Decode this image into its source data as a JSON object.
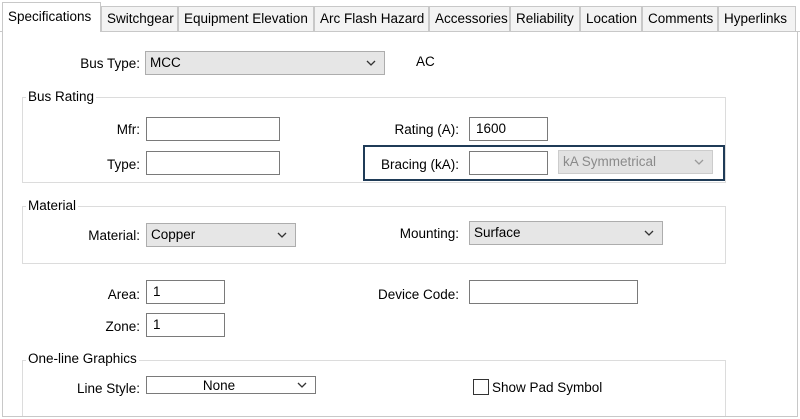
{
  "tabs": [
    {
      "label": "Specifications"
    },
    {
      "label": "Switchgear"
    },
    {
      "label": "Equipment Elevation"
    },
    {
      "label": "Arc Flash Hazard"
    },
    {
      "label": "Accessories"
    },
    {
      "label": "Reliability"
    },
    {
      "label": "Location"
    },
    {
      "label": "Comments"
    },
    {
      "label": "Hyperlinks"
    }
  ],
  "bus_type": {
    "label": "Bus Type:",
    "value": "MCC",
    "current": "AC"
  },
  "bus_rating": {
    "title": "Bus Rating",
    "mfr_label": "Mfr:",
    "mfr_value": "",
    "type_label": "Type:",
    "type_value": "",
    "rating_label": "Rating (A):",
    "rating_value": "1600",
    "bracing_label": "Bracing (kA):",
    "bracing_value": "",
    "bracing_unit": "kA Symmetrical"
  },
  "material": {
    "title": "Material",
    "material_label": "Material:",
    "material_value": "Copper",
    "mounting_label": "Mounting:",
    "mounting_value": "Surface"
  },
  "area": {
    "label": "Area:",
    "value": "1"
  },
  "zone": {
    "label": "Zone:",
    "value": "1"
  },
  "device_code": {
    "label": "Device Code:",
    "value": ""
  },
  "oneline": {
    "title": "One-line Graphics",
    "line_style_label": "Line Style:",
    "line_style_value": "None",
    "show_pad_label": "Show Pad Symbol"
  }
}
